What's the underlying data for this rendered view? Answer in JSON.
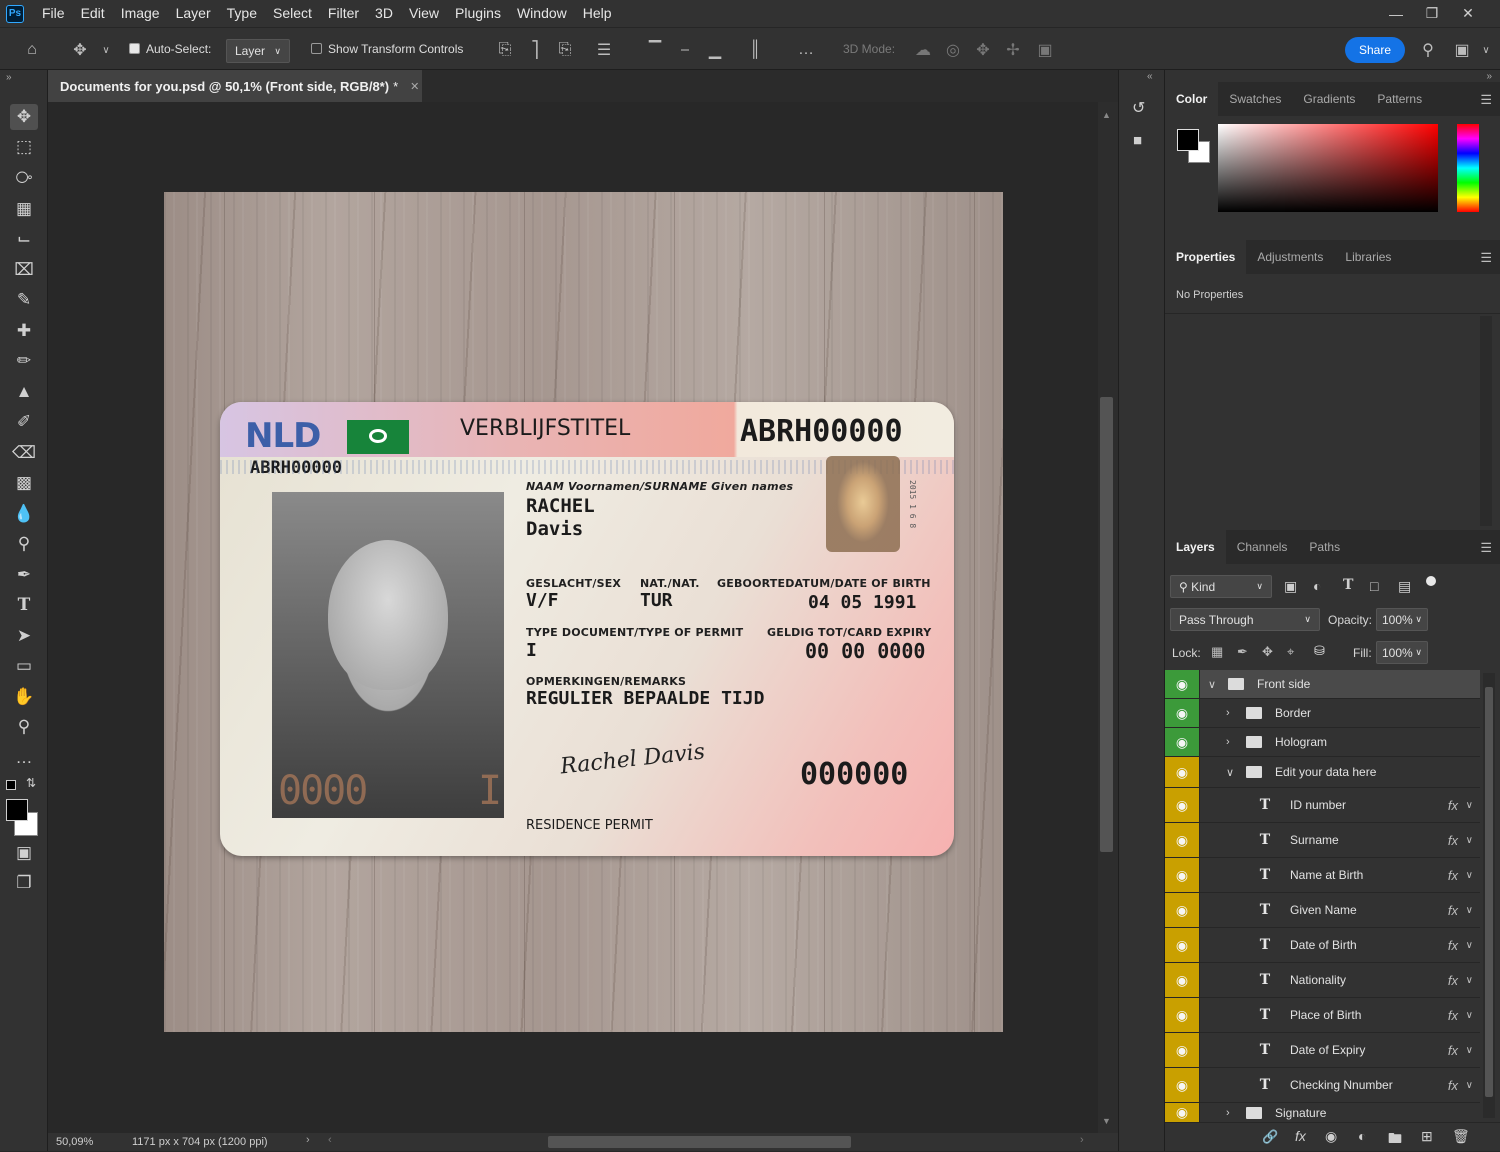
{
  "app": {
    "logo": "Ps",
    "menu": [
      "File",
      "Edit",
      "Image",
      "Layer",
      "Type",
      "Select",
      "Filter",
      "3D",
      "View",
      "Plugins",
      "Window",
      "Help"
    ]
  },
  "options": {
    "auto_select_label": "Auto-Select:",
    "auto_select_checked": true,
    "target": "Layer",
    "transform_label": "Show Transform Controls",
    "transform_checked": false,
    "mode_3d_label": "3D Mode:",
    "share_label": "Share"
  },
  "document": {
    "tab_title": "Documents for you.psd @ 50,1% (Front side, RGB/8*)",
    "modified_mark": "*",
    "zoom": "50,09%",
    "doc_info": "1171 px x 704 px (1200 ppi)"
  },
  "card": {
    "country": "NLD",
    "title": "VERBLIJFSTITEL",
    "doc_number_top": "ABRH00000",
    "doc_number_left": "ABRH00000",
    "name_label": "NAAM Voornamen/SURNAME Given names",
    "surname": "RACHEL",
    "given": "Davis",
    "sex_label": "GESLACHT/SEX",
    "sex": "V/F",
    "nat_label": "NAT./NAT.",
    "nat": "TUR",
    "dob_label": "GEBOORTEDATUM/DATE OF BIRTH",
    "dob": "04 05 1991",
    "type_label": "TYPE DOCUMENT/TYPE OF PERMIT",
    "type": "I",
    "expiry_label": "GELDIG TOT/CARD EXPIRY",
    "expiry": "00 00 0000",
    "remarks_label": "OPMERKINGEN/REMARKS",
    "remarks": "REGULIER BEPAALDE TIJD",
    "serial": "000000",
    "footer": "RESIDENCE PERMIT",
    "photo_number": "0000",
    "photo_mark": "I",
    "signature": "Rachel Davis",
    "ghost_side_text": "2015 1 6 8"
  },
  "color_panel": {
    "tabs": [
      "Color",
      "Swatches",
      "Gradients",
      "Patterns"
    ],
    "active": "Color"
  },
  "properties_panel": {
    "tabs": [
      "Properties",
      "Adjustments",
      "Libraries"
    ],
    "active": "Properties",
    "empty_text": "No Properties"
  },
  "layers_panel": {
    "tabs": [
      "Layers",
      "Channels",
      "Paths"
    ],
    "active": "Layers",
    "filter_kind": "Kind",
    "blend_mode": "Pass Through",
    "opacity_label": "Opacity:",
    "opacity": "100%",
    "lock_label": "Lock:",
    "fill_label": "Fill:",
    "fill": "100%",
    "layers": [
      {
        "name": "Front side",
        "type": "group",
        "level": 0,
        "expanded": true,
        "color": "#3c9a3a"
      },
      {
        "name": "Border",
        "type": "group",
        "level": 1,
        "expanded": false,
        "color": "#3c9a3a"
      },
      {
        "name": "Hologram",
        "type": "group",
        "level": 1,
        "expanded": false,
        "color": "#3c9a3a"
      },
      {
        "name": "Edit your data here",
        "type": "group",
        "level": 1,
        "expanded": true,
        "color": "#c9a000"
      },
      {
        "name": "ID number",
        "type": "text",
        "level": 2,
        "fx": true,
        "color": "#c9a000"
      },
      {
        "name": "Surname",
        "type": "text",
        "level": 2,
        "fx": true,
        "color": "#c9a000"
      },
      {
        "name": "Name at Birth",
        "type": "text",
        "level": 2,
        "fx": true,
        "color": "#c9a000"
      },
      {
        "name": "Given Name",
        "type": "text",
        "level": 2,
        "fx": true,
        "color": "#c9a000"
      },
      {
        "name": "Date of Birth",
        "type": "text",
        "level": 2,
        "fx": true,
        "color": "#c9a000"
      },
      {
        "name": "Nationality",
        "type": "text",
        "level": 2,
        "fx": true,
        "color": "#c9a000"
      },
      {
        "name": "Place of Birth",
        "type": "text",
        "level": 2,
        "fx": true,
        "color": "#c9a000"
      },
      {
        "name": "Date of Expiry",
        "type": "text",
        "level": 2,
        "fx": true,
        "color": "#c9a000"
      },
      {
        "name": "Checking Nnumber",
        "type": "text",
        "level": 2,
        "fx": true,
        "color": "#c9a000"
      },
      {
        "name": "Signature",
        "type": "group",
        "level": 1,
        "expanded": false,
        "color": "#c9a000"
      }
    ]
  },
  "colors": {
    "accent": "#1473e6",
    "eye_green": "#3c9a3a",
    "eye_yellow": "#c9a000"
  }
}
